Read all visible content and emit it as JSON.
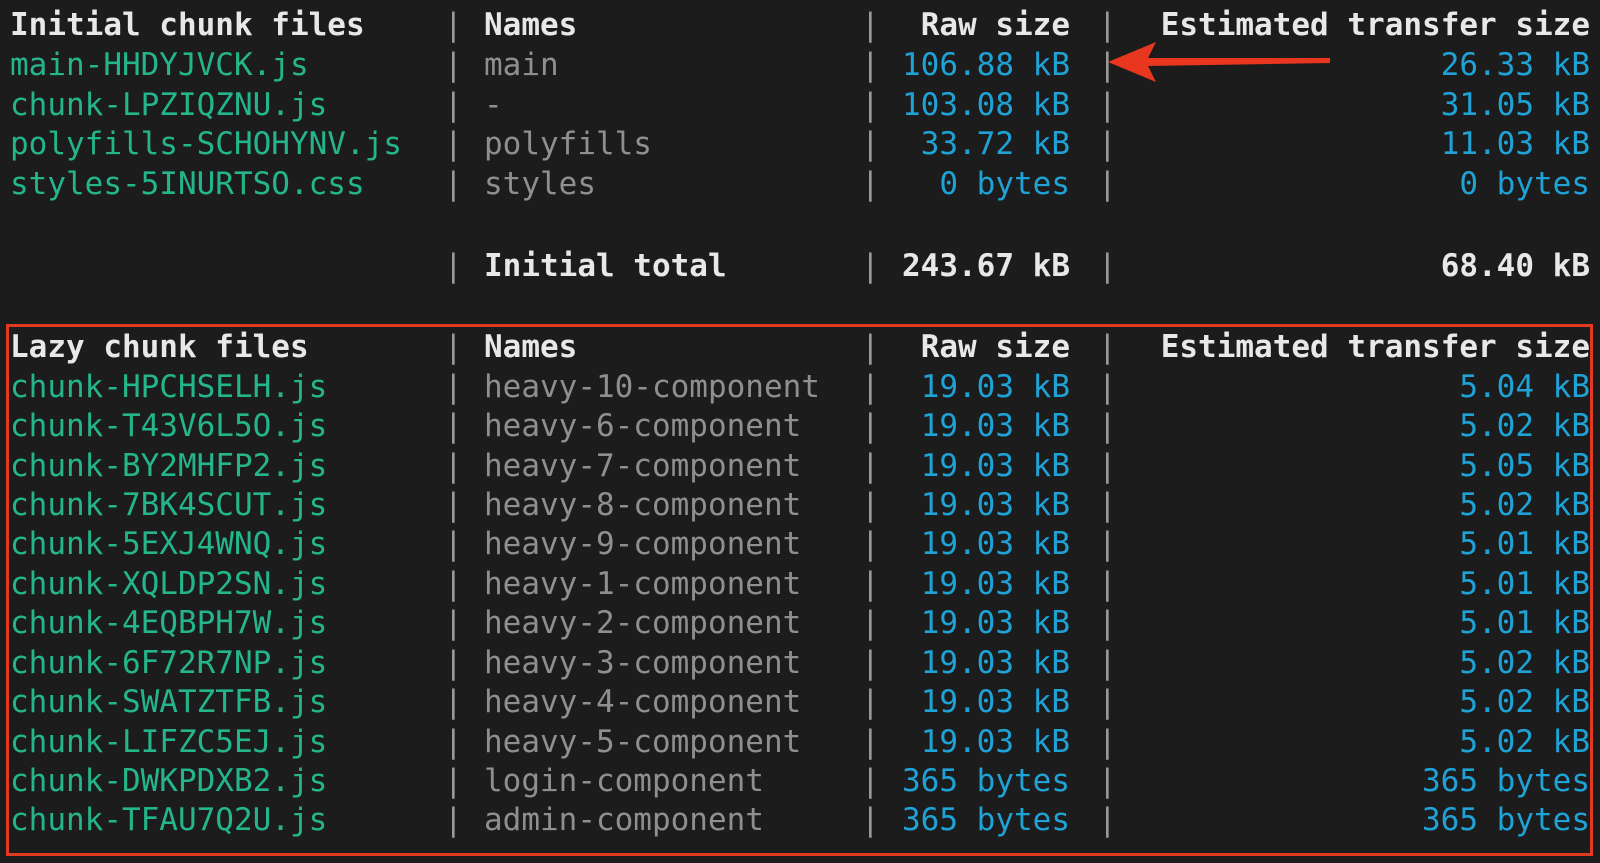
{
  "initial": {
    "header": {
      "file": "Initial chunk files",
      "name": "Names",
      "raw": "Raw size",
      "est": "Estimated transfer size"
    },
    "rows": [
      {
        "file": "main-HHDYJVCK.js",
        "name": "main",
        "raw": "106.88 kB",
        "est": "26.33 kB"
      },
      {
        "file": "chunk-LPZIQZNU.js",
        "name": "-",
        "raw": "103.08 kB",
        "est": "31.05 kB"
      },
      {
        "file": "polyfills-SCHOHYNV.js",
        "name": "polyfills",
        "raw": "33.72 kB",
        "est": "11.03 kB"
      },
      {
        "file": "styles-5INURTSO.css",
        "name": "styles",
        "raw": "0 bytes",
        "est": "0 bytes"
      }
    ],
    "total": {
      "label": "Initial total",
      "raw": "243.67 kB",
      "est": "68.40 kB"
    }
  },
  "lazy": {
    "header": {
      "file": "Lazy chunk files",
      "name": "Names",
      "raw": "Raw size",
      "est": "Estimated transfer size"
    },
    "rows": [
      {
        "file": "chunk-HPCHSELH.js",
        "name": "heavy-10-component",
        "raw": "19.03 kB",
        "est": "5.04 kB"
      },
      {
        "file": "chunk-T43V6L5O.js",
        "name": "heavy-6-component",
        "raw": "19.03 kB",
        "est": "5.02 kB"
      },
      {
        "file": "chunk-BY2MHFP2.js",
        "name": "heavy-7-component",
        "raw": "19.03 kB",
        "est": "5.05 kB"
      },
      {
        "file": "chunk-7BK4SCUT.js",
        "name": "heavy-8-component",
        "raw": "19.03 kB",
        "est": "5.02 kB"
      },
      {
        "file": "chunk-5EXJ4WNQ.js",
        "name": "heavy-9-component",
        "raw": "19.03 kB",
        "est": "5.01 kB"
      },
      {
        "file": "chunk-XQLDP2SN.js",
        "name": "heavy-1-component",
        "raw": "19.03 kB",
        "est": "5.01 kB"
      },
      {
        "file": "chunk-4EQBPH7W.js",
        "name": "heavy-2-component",
        "raw": "19.03 kB",
        "est": "5.01 kB"
      },
      {
        "file": "chunk-6F72R7NP.js",
        "name": "heavy-3-component",
        "raw": "19.03 kB",
        "est": "5.02 kB"
      },
      {
        "file": "chunk-SWATZTFB.js",
        "name": "heavy-4-component",
        "raw": "19.03 kB",
        "est": "5.02 kB"
      },
      {
        "file": "chunk-LIFZC5EJ.js",
        "name": "heavy-5-component",
        "raw": "19.03 kB",
        "est": "5.02 kB"
      },
      {
        "file": "chunk-DWKPDXB2.js",
        "name": "login-component",
        "raw": "365 bytes",
        "est": "365 bytes"
      },
      {
        "file": "chunk-TFAU7Q2U.js",
        "name": "admin-component",
        "raw": "365 bytes",
        "est": "365 bytes"
      }
    ]
  },
  "separator": "|",
  "colors": {
    "background": "#1c1c1c",
    "file": "#24b58a",
    "size": "#1fa2d6",
    "name": "#8f8f8f",
    "header": "#e8e8e8",
    "highlight": "#e23a22"
  },
  "annotations": {
    "arrow_icon": "red-arrow-icon",
    "highlight_box": "red-outline-box"
  }
}
